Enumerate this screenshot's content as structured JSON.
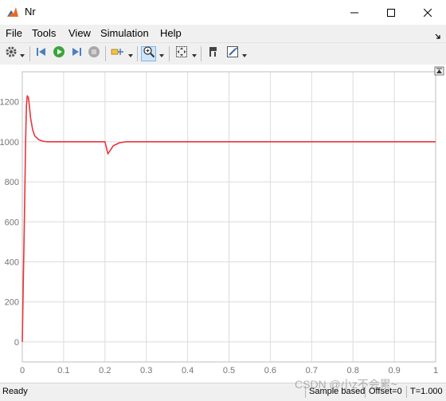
{
  "window": {
    "title": "Nr",
    "icon": "matlab-scope-icon",
    "controls": [
      "minimize-icon",
      "maximize-icon",
      "close-icon"
    ]
  },
  "menu": {
    "items": [
      "File",
      "Tools",
      "View",
      "Simulation",
      "Help"
    ]
  },
  "toolbar": {
    "buttons": [
      "settings-icon",
      "step-back-icon",
      "run-icon",
      "step-forward-icon",
      "stop-icon",
      "highlight-icon",
      "zoom-in-icon",
      "autoscale-icon",
      "cursor-measure-icon",
      "style-icon"
    ]
  },
  "status": {
    "ready": "Ready",
    "sample": "Sample based",
    "offset": "Offset=0",
    "time": "T=1.000"
  },
  "watermark": "CSDN @小z不会累~",
  "colors": {
    "trace": "#e8353b",
    "grid": "#dcdcdc",
    "axis_text": "#757575"
  },
  "chart_data": {
    "type": "line",
    "title": "",
    "xlabel": "",
    "ylabel": "",
    "xlim": [
      0,
      1
    ],
    "ylim": [
      -100,
      1350
    ],
    "xticks": [
      "0",
      "0.1",
      "0.2",
      "0.3",
      "0.4",
      "0.5",
      "0.6",
      "0.7",
      "0.8",
      "0.9",
      "1"
    ],
    "yticks": [
      "0",
      "200",
      "400",
      "600",
      "800",
      "1000",
      "1200"
    ],
    "grid": true,
    "series": [
      {
        "color": "#e8353b",
        "x": [
          0,
          0.002,
          0.005,
          0.008,
          0.01,
          0.012,
          0.015,
          0.02,
          0.025,
          0.03,
          0.04,
          0.05,
          0.06,
          0.08,
          0.1,
          0.15,
          0.199,
          0.2,
          0.203,
          0.207,
          0.212,
          0.22,
          0.235,
          0.25,
          0.28,
          0.3,
          0.4,
          0.5,
          0.6,
          0.7,
          0.8,
          0.9,
          1.0
        ],
        "y": [
          0,
          250,
          600,
          1000,
          1180,
          1230,
          1220,
          1120,
          1060,
          1030,
          1010,
          1003,
          1000,
          1000,
          1000,
          1000,
          1000,
          1000,
          975,
          940,
          955,
          980,
          995,
          1000,
          1000,
          1000,
          1000,
          1000,
          1000,
          1000,
          1000,
          1000,
          1000
        ]
      }
    ]
  }
}
